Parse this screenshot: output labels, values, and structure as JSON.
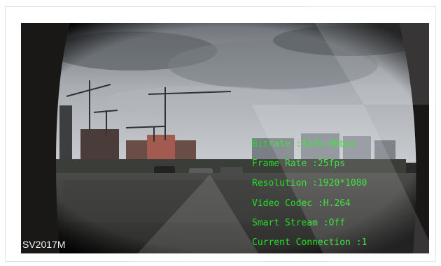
{
  "camera": {
    "name": "SV2017M"
  },
  "osd": {
    "bitrate": "Bitrate :4376.0Kbps",
    "frame_rate": "Frame Rate :25fps",
    "resolution": "Resolution :1920*1080",
    "video_codec": "Video Codec :H.264",
    "smart_stream": "Smart Stream :Off",
    "current_connection": "Current Connection :1"
  },
  "colors": {
    "osd_text": "#22e022",
    "label_text": "#f0f0f0"
  }
}
